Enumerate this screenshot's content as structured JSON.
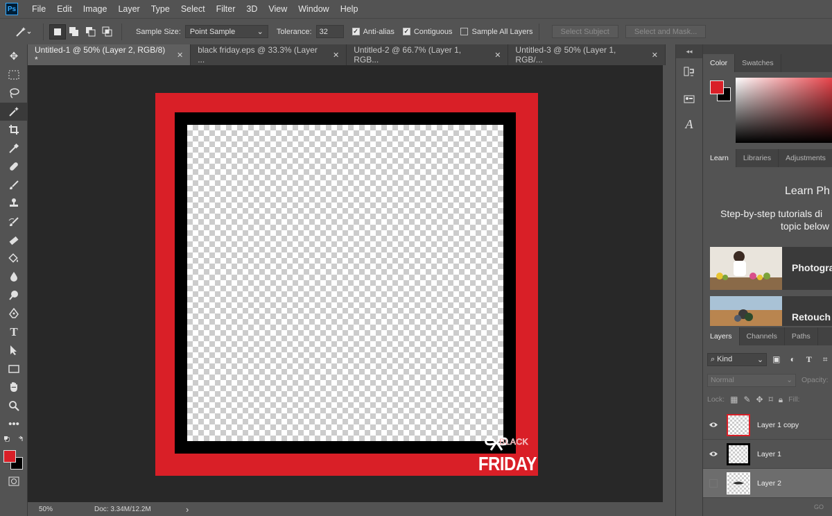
{
  "app": {
    "logo": "Ps"
  },
  "menu": [
    "File",
    "Edit",
    "Image",
    "Layer",
    "Type",
    "Select",
    "Filter",
    "3D",
    "View",
    "Window",
    "Help"
  ],
  "options": {
    "sample_size_label": "Sample Size:",
    "sample_size_value": "Point Sample",
    "tolerance_label": "Tolerance:",
    "tolerance_value": "32",
    "anti_alias": "Anti-alias",
    "contiguous": "Contiguous",
    "sample_all_layers": "Sample All Layers",
    "select_subject": "Select Subject",
    "select_and_mask": "Select and Mask..."
  },
  "tabs": [
    {
      "label": "Untitled-1 @ 50% (Layer 2, RGB/8) *",
      "active": true
    },
    {
      "label": "black friday.eps @ 33.3% (Layer ...",
      "active": false
    },
    {
      "label": "Untitled-2 @ 66.7% (Layer 1, RGB...",
      "active": false
    },
    {
      "label": "Untitled-3 @ 50% (Layer 1, RGB/...",
      "active": false
    }
  ],
  "tab_close": "✕",
  "artwork": {
    "black": "BLACK",
    "friday": "FRIDAY",
    "frame_color": "#d91f27"
  },
  "status": {
    "zoom": "50%",
    "doc": "Doc: 3.34M/12.2M",
    "arrow": "›"
  },
  "color_panel": {
    "tabs": [
      "Color",
      "Swatches"
    ],
    "fg": "#d91f27",
    "bg": "#000000"
  },
  "learn_panel": {
    "tabs": [
      "Learn",
      "Libraries",
      "Adjustments"
    ],
    "title": "Learn Ph",
    "subtitle_1": "Step-by-step tutorials di",
    "subtitle_2": "topic below",
    "cards": [
      "Photogra",
      "Retouch"
    ]
  },
  "layers_panel": {
    "tabs": [
      "Layers",
      "Channels",
      "Paths"
    ],
    "kind": "Kind",
    "blend": "Normal",
    "opacity": "Opacity:",
    "lock": "Lock:",
    "fill": "Fill:",
    "layers": [
      {
        "name": "Layer 1 copy",
        "visible": true,
        "selected": false
      },
      {
        "name": "Layer 1",
        "visible": true,
        "selected": false
      },
      {
        "name": "Layer 2",
        "visible": false,
        "selected": true
      }
    ],
    "footer": "GO"
  }
}
